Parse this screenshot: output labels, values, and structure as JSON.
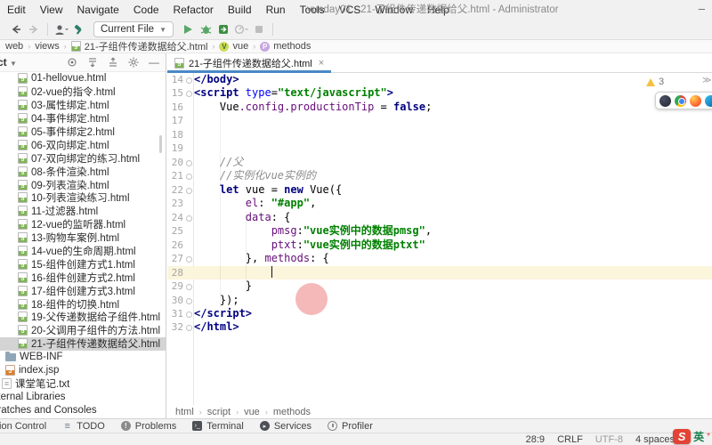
{
  "window": {
    "title": "vueday01 - 21-子组件传递数据给父.html - Administrator",
    "minimize": "–"
  },
  "menu": {
    "items": [
      "Edit",
      "View",
      "Navigate",
      "Code",
      "Refactor",
      "Build",
      "Run",
      "Tools",
      "VCS",
      "Window",
      "Help"
    ]
  },
  "toolbar": {
    "run_config": "Current File",
    "dropdown_arrow": "▾"
  },
  "breadcrumb": {
    "segments": [
      {
        "text": "web",
        "icon": "none"
      },
      {
        "text": "views",
        "icon": "none"
      },
      {
        "text": "21-子组件传递数据给父.html",
        "icon": "html"
      },
      {
        "text": "vue",
        "icon": "vue"
      },
      {
        "text": "methods",
        "icon": "methods"
      }
    ]
  },
  "project": {
    "header": "Project",
    "items": [
      {
        "label": "01-hellovue.html",
        "icon": "html",
        "lvl": 3
      },
      {
        "label": "02-vue的指令.html",
        "icon": "html",
        "lvl": 3
      },
      {
        "label": "03-属性绑定.html",
        "icon": "html",
        "lvl": 3
      },
      {
        "label": "04-事件绑定.html",
        "icon": "html",
        "lvl": 3
      },
      {
        "label": "05-事件绑定2.html",
        "icon": "html",
        "lvl": 3
      },
      {
        "label": "06-双向绑定.html",
        "icon": "html",
        "lvl": 3
      },
      {
        "label": "07-双向绑定的练习.html",
        "icon": "html",
        "lvl": 3
      },
      {
        "label": "08-条件渲染.html",
        "icon": "html",
        "lvl": 3
      },
      {
        "label": "09-列表渲染.html",
        "icon": "html",
        "lvl": 3
      },
      {
        "label": "10-列表渲染练习.html",
        "icon": "html",
        "lvl": 3
      },
      {
        "label": "11-过滤器.html",
        "icon": "html",
        "lvl": 3
      },
      {
        "label": "12-vue的监听器.html",
        "icon": "html",
        "lvl": 3
      },
      {
        "label": "13-购物车案例.html",
        "icon": "html",
        "lvl": 3
      },
      {
        "label": "14-vue的生命周期.html",
        "icon": "html",
        "lvl": 3
      },
      {
        "label": "15-组件创建方式1.html",
        "icon": "html",
        "lvl": 3
      },
      {
        "label": "16-组件创建方式2.html",
        "icon": "html",
        "lvl": 3
      },
      {
        "label": "17-组件创建方式3.html",
        "icon": "html",
        "lvl": 3
      },
      {
        "label": "18-组件的切换.html",
        "icon": "html",
        "lvl": 3
      },
      {
        "label": "19-父传递数据给子组件.html",
        "icon": "html",
        "lvl": 3
      },
      {
        "label": "20-父调用子组件的方法.html",
        "icon": "html",
        "lvl": 3
      },
      {
        "label": "21-子组件传递数据给父.html",
        "icon": "html",
        "lvl": 3,
        "selected": true
      },
      {
        "label": "WEB-INF",
        "icon": "folder",
        "lvl": 2
      },
      {
        "label": "index.jsp",
        "icon": "jsp",
        "lvl": 2
      },
      {
        "label": "课堂笔记.txt",
        "icon": "txt",
        "lvl": 1
      },
      {
        "label": "External Libraries",
        "icon": "none",
        "lvl": 0
      },
      {
        "label": "Scratches and Consoles",
        "icon": "none",
        "lvl": 0
      }
    ]
  },
  "editor": {
    "tab": "21-子组件传递数据给父.html",
    "tab_close": "×",
    "warning_count": "3",
    "inspection_chevron": "≫",
    "crumbs": [
      "html",
      "script",
      "vue",
      "methods"
    ],
    "lines": [
      {
        "n": "14",
        "indent": 0,
        "fold": true,
        "tokens": [
          [
            "</body>",
            "tag"
          ]
        ]
      },
      {
        "n": "15",
        "indent": 0,
        "fold": true,
        "tokens": [
          [
            "<script ",
            "tag"
          ],
          [
            "type",
            "attr"
          ],
          [
            "=",
            "pln"
          ],
          [
            "\"text/javascript\"",
            "str"
          ],
          [
            ">",
            "tag"
          ]
        ]
      },
      {
        "n": "16",
        "indent": 1,
        "fold": false,
        "tokens": [
          [
            "Vue",
            "pln"
          ],
          [
            ".config.productionTip",
            "fld"
          ],
          [
            " = ",
            "pln"
          ],
          [
            "false",
            "kw"
          ],
          [
            ";",
            "pln"
          ]
        ]
      },
      {
        "n": "17",
        "indent": 1,
        "fold": false,
        "tokens": []
      },
      {
        "n": "18",
        "indent": 1,
        "fold": false,
        "tokens": []
      },
      {
        "n": "19",
        "indent": 1,
        "fold": false,
        "tokens": []
      },
      {
        "n": "20",
        "indent": 1,
        "fold": true,
        "tokens": [
          [
            "//父",
            "cmt"
          ]
        ]
      },
      {
        "n": "21",
        "indent": 1,
        "fold": true,
        "tokens": [
          [
            "//实例化vue实例的",
            "cmt"
          ]
        ]
      },
      {
        "n": "22",
        "indent": 1,
        "fold": true,
        "tokens": [
          [
            "let",
            "kw"
          ],
          [
            " vue = ",
            "pln"
          ],
          [
            "new",
            "kw"
          ],
          [
            " Vue({",
            "pln"
          ]
        ]
      },
      {
        "n": "23",
        "indent": 2,
        "fold": false,
        "tokens": [
          [
            "el",
            "fld"
          ],
          [
            ": ",
            "pln"
          ],
          [
            "\"#app\"",
            "str"
          ],
          [
            ",",
            "pln"
          ]
        ]
      },
      {
        "n": "24",
        "indent": 2,
        "fold": true,
        "tokens": [
          [
            "data",
            "fld"
          ],
          [
            ": {",
            "pln"
          ]
        ]
      },
      {
        "n": "25",
        "indent": 3,
        "fold": false,
        "tokens": [
          [
            "pmsg",
            "fld"
          ],
          [
            ":",
            "pln"
          ],
          [
            "\"vue实例中的数据pmsg\"",
            "str"
          ],
          [
            ",",
            "pln"
          ]
        ]
      },
      {
        "n": "26",
        "indent": 3,
        "fold": false,
        "tokens": [
          [
            "ptxt",
            "fld"
          ],
          [
            ":",
            "pln"
          ],
          [
            "\"vue实例中的数据ptxt\"",
            "str"
          ]
        ]
      },
      {
        "n": "27",
        "indent": 2,
        "fold": true,
        "tokens": [
          [
            "}, ",
            "pln"
          ],
          [
            "methods",
            "fld"
          ],
          [
            ": {",
            "pln"
          ]
        ]
      },
      {
        "n": "28",
        "indent": 3,
        "fold": false,
        "current": true,
        "tokens": []
      },
      {
        "n": "29",
        "indent": 2,
        "fold": true,
        "tokens": [
          [
            "}",
            "pln"
          ]
        ]
      },
      {
        "n": "30",
        "indent": 1,
        "fold": true,
        "tokens": [
          [
            "});",
            "pln"
          ]
        ]
      },
      {
        "n": "31",
        "indent": 0,
        "fold": true,
        "tokens": [
          [
            "</script>",
            "tag"
          ]
        ]
      },
      {
        "n": "32",
        "indent": 0,
        "fold": true,
        "tokens": [
          [
            "</html>",
            "tag"
          ]
        ]
      }
    ]
  },
  "stripe": {
    "items": [
      {
        "label": "Version Control",
        "icon": "vc"
      },
      {
        "label": "TODO",
        "icon": "todo"
      },
      {
        "label": "Problems",
        "icon": "problems"
      },
      {
        "label": "Terminal",
        "icon": "terminal"
      },
      {
        "label": "Services",
        "icon": "services"
      },
      {
        "label": "Profiler",
        "icon": "profiler"
      }
    ]
  },
  "status": {
    "items": [
      {
        "text": "28:9",
        "dim": false
      },
      {
        "text": "CRLF",
        "dim": false
      },
      {
        "text": "UTF-8",
        "dim": true
      },
      {
        "text": "4 spaces",
        "dim": false
      }
    ],
    "ime": {
      "logo": "S",
      "lang": "英",
      "dot": "*"
    }
  }
}
